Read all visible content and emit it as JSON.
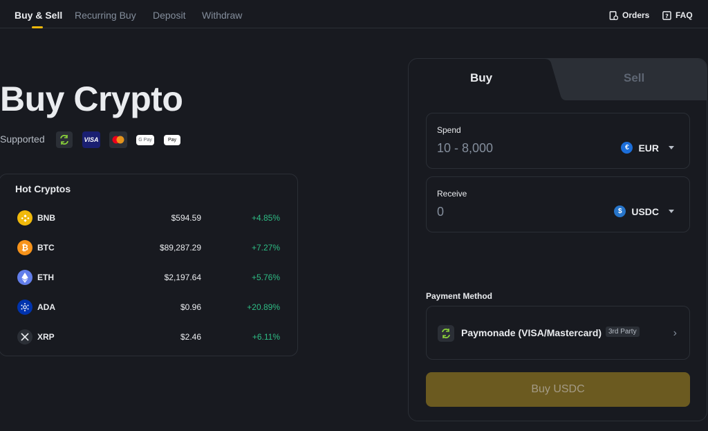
{
  "nav": {
    "tabs": [
      "Buy & Sell",
      "Recurring Buy",
      "Deposit",
      "Withdraw"
    ],
    "orders": "Orders",
    "faq": "FAQ"
  },
  "hero": {
    "title": "Buy Crypto",
    "supported_label": "Supported",
    "payment_icons": [
      "paymonade-icon",
      "visa-icon",
      "mastercard-icon",
      "google-pay-icon",
      "apple-pay-icon"
    ],
    "visa_text": "VISA",
    "gpay_text": "G Pay",
    "applepay_text": "Pay"
  },
  "hot": {
    "title": "Hot Cryptos",
    "rows": [
      {
        "symbol": "BNB",
        "price": "$594.59",
        "change": "+4.85%",
        "color": "#f0b90b"
      },
      {
        "symbol": "BTC",
        "price": "$89,287.29",
        "change": "+7.27%",
        "color": "#f7931a"
      },
      {
        "symbol": "ETH",
        "price": "$2,197.64",
        "change": "+5.76%",
        "color": "#627eea"
      },
      {
        "symbol": "ADA",
        "price": "$0.96",
        "change": "+20.89%",
        "color": "#0033ad"
      },
      {
        "symbol": "XRP",
        "price": "$2.46",
        "change": "+6.11%",
        "color": "#23292f"
      }
    ]
  },
  "trade": {
    "buy_tab": "Buy",
    "sell_tab": "Sell",
    "spend_label": "Spend",
    "spend_placeholder": "10 - 8,000",
    "spend_currency": "EUR",
    "receive_label": "Receive",
    "receive_value": "0",
    "receive_currency": "USDC",
    "payment_method_label": "Payment Method",
    "payment_method_name": "Paymonade (VISA/Mastercard)",
    "payment_badge": "3rd Party",
    "buy_button": "Buy USDC"
  },
  "colors": {
    "accent": "#f0b90b",
    "positive": "#2ebd85",
    "background": "#181a20"
  }
}
